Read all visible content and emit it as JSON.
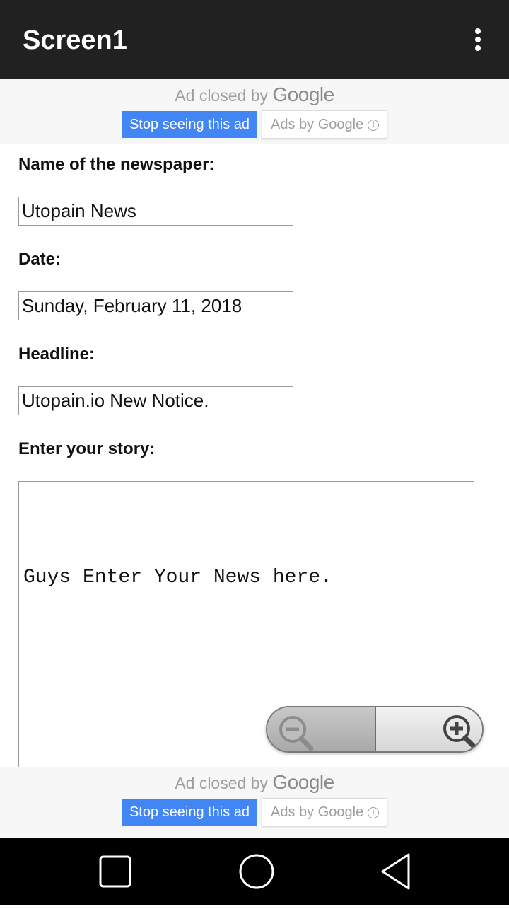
{
  "app": {
    "title": "Screen1"
  },
  "ad_banner": {
    "closed_text": "Ad closed by",
    "google_text": "Google",
    "stop_label": "Stop seeing this ad",
    "ads_by_label": "Ads by Google"
  },
  "form": {
    "newspaper_label": "Name of the newspaper:",
    "newspaper_value": "Utopain News",
    "date_label": "Date:",
    "date_value": "Sunday, February 11, 2018",
    "headline_label": "Headline:",
    "headline_value": "Utopain.io New Notice.",
    "story_label": "Enter your story:",
    "story_value": "Guys Enter Your News here."
  },
  "icons": {
    "menu": "overflow-menu-icon",
    "zoom_out": "zoom-out-icon",
    "zoom_in": "zoom-in-icon",
    "nav_recents": "recents-icon",
    "nav_home": "home-icon",
    "nav_back": "back-icon"
  },
  "colors": {
    "appbar": "#212121",
    "ad_button": "#4285f4"
  }
}
